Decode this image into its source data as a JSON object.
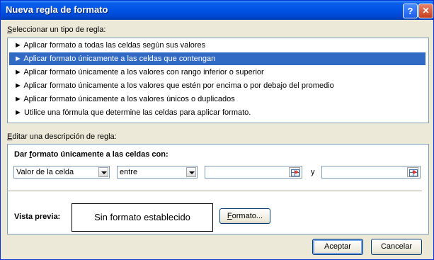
{
  "window": {
    "title": "Nueva regla de formato",
    "help_glyph": "?",
    "close_glyph": "✕"
  },
  "rule_type_section": {
    "label_access": "S",
    "label_rest": "eleccionar un tipo de regla:",
    "items": [
      {
        "label": "► Aplicar formato a todas las celdas según sus valores"
      },
      {
        "label": "► Aplicar formato únicamente a las celdas que contengan"
      },
      {
        "label": "► Aplicar formato únicamente a los valores con rango inferior o superior"
      },
      {
        "label": "► Aplicar formato únicamente a los valores que estén por encima o por debajo del promedio"
      },
      {
        "label": "► Aplicar formato únicamente a los valores únicos o duplicados"
      },
      {
        "label": "► Utilice una fórmula que determine las celdas para aplicar formato."
      }
    ],
    "selected_index": 1
  },
  "description_section": {
    "label_access": "E",
    "label_rest": "ditar una descripción de regla:",
    "heading_pre": "Dar ",
    "heading_access": "f",
    "heading_post": "ormato únicamente a las celdas con:",
    "condition_combo": {
      "value": "Valor de la celda"
    },
    "operator_combo": {
      "value": "entre"
    },
    "value1": "",
    "conjunction": "y",
    "value2": "",
    "preview_label": "Vista previa:",
    "preview_text": "Sin formato establecido",
    "format_button_access": "F",
    "format_button_rest": "ormato..."
  },
  "buttons": {
    "ok": "Aceptar",
    "cancel": "Cancelar"
  },
  "colors": {
    "selection": "#316ac5",
    "titlebar": "#0055e5",
    "dialog_bg": "#ece9d8"
  }
}
